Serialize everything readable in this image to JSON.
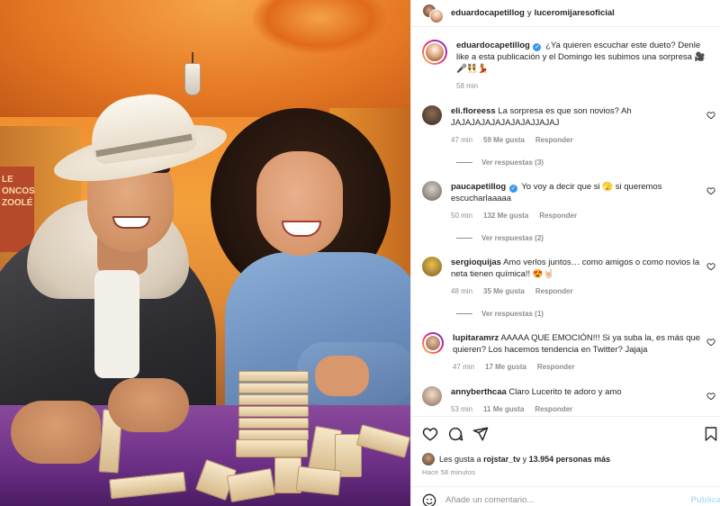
{
  "header": {
    "user1": "eduardocapetillog",
    "connector": "y",
    "user2": "luceromijaresoficial"
  },
  "photo": {
    "poster_lines": [
      "LE",
      "ONCOS",
      "ZOOLÉ"
    ]
  },
  "caption": {
    "user": "eduardocapetillog",
    "text": "¿Ya quieren escuchar este dueto? Denle like a esta publicación y el Domingo les subimos una sorpresa",
    "emojis": "🎥🎤👯💃",
    "time": "58 min"
  },
  "comments": [
    {
      "user": "eli.floreess",
      "verified": false,
      "text": "La sorpresa es que son novios? Ah JAJAJAJAJAJAJAJAJJAJAJ",
      "time": "47 min",
      "likes": "59 Me gusta",
      "reply": "Responder",
      "view_replies": "Ver respuestas (3)"
    },
    {
      "user": "paucapetillog",
      "verified": true,
      "text": "Yo voy a decir que si 🫣 si queremos escucharlaaaaa",
      "time": "50 min",
      "likes": "132 Me gusta",
      "reply": "Responder",
      "view_replies": "Ver respuestas (2)"
    },
    {
      "user": "sergioquijas",
      "verified": false,
      "text": "Amo verlos juntos… como amigos o como novios la neta tienen química!! 😍🤘🏻",
      "time": "48 min",
      "likes": "35 Me gusta",
      "reply": "Responder",
      "view_replies": "Ver respuestas (1)"
    },
    {
      "user": "lupitaramrz",
      "verified": false,
      "text": "AAAAA QUE EMOCIÓN!!! Si ya suba la, es más que quieren? Los hacemos tendencia en Twitter? Jajaja",
      "time": "47 min",
      "likes": "17 Me gusta",
      "reply": "Responder"
    },
    {
      "user": "annyberthcaa",
      "verified": false,
      "text": "Claro Lucerito te adoro y amo",
      "time": "53 min",
      "likes": "11 Me gusta",
      "reply": "Responder"
    }
  ],
  "likes_bar": {
    "prefix": "Les gusta a",
    "user": "rojstar_tv",
    "middle": "y",
    "count": "13.954 personas más",
    "time_ago": "Hace 58 minutos"
  },
  "add_comment": {
    "placeholder": "Añade un comentario...",
    "publish": "Publicar"
  },
  "colors": {
    "verified": "#3897f0",
    "secondary_text": "#8e8e8e",
    "publish_disabled": "#b2dffc"
  },
  "icons": [
    "heart-icon",
    "comment-icon",
    "share-icon",
    "bookmark-icon",
    "emoji-icon",
    "verified-icon"
  ]
}
